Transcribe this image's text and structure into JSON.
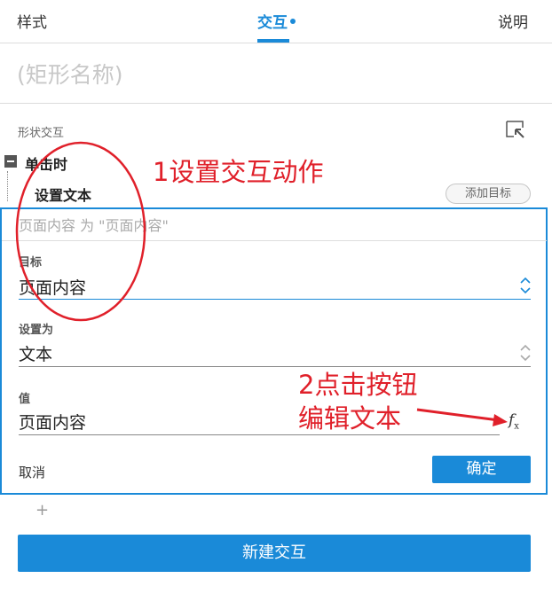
{
  "tabs": {
    "style": "样式",
    "interactions": "交互",
    "notes": "说明"
  },
  "shape_name": "(矩形名称)",
  "section_label": "形状交互",
  "event": {
    "label": "单击时"
  },
  "action": {
    "label": "设置文本"
  },
  "add_target_label": "添加目标",
  "editor": {
    "summary": "页面内容 为 \"页面内容\"",
    "target": {
      "label": "目标",
      "value": "页面内容"
    },
    "set_as": {
      "label": "设置为",
      "value": "文本"
    },
    "value": {
      "label": "值",
      "value": "页面内容"
    },
    "cancel_label": "取消",
    "ok_label": "确定"
  },
  "add_plus": "+",
  "new_interaction_label": "新建交互",
  "annotations": {
    "note1": "1设置交互动作",
    "note2_line1": "2点击按钮",
    "note2_line2": "编辑文本"
  },
  "colors": {
    "accent": "#1a8ad8",
    "annotation": "#e0202a"
  },
  "icons": {
    "select_target": "select-arrow-icon",
    "function": "fx-icon",
    "chevron": "chevron-up-down-icon"
  }
}
